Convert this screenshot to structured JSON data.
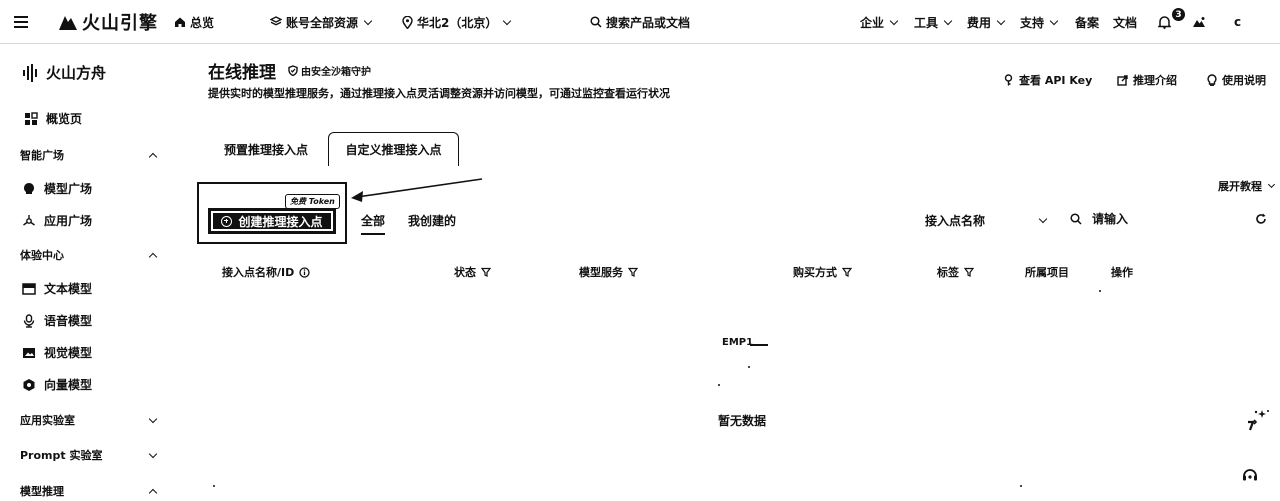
{
  "topbar": {
    "brand": "火山引擎",
    "overview": "总览",
    "account_scope": "账号全部资源",
    "region": "华北2（北京）",
    "search_placeholder": "搜索产品或文档",
    "menus": [
      "企业",
      "工具",
      "费用",
      "支持"
    ],
    "record": "备案",
    "docs": "文档",
    "notification_count": "3",
    "avatar_initial": "c"
  },
  "sidebar": {
    "product": "火山方舟",
    "overview": "概览页",
    "groups": {
      "smart_plaza": "智能广场",
      "experience": "体验中心",
      "app_lab": "应用实验室",
      "prompt_lab": "Prompt 实验室",
      "model_inference": "模型推理"
    },
    "items": {
      "model_plaza": "模型广场",
      "app_plaza": "应用广场",
      "text_model": "文本模型",
      "voice_model": "语音模型",
      "vision_model": "视觉模型",
      "vector_model": "向量模型"
    }
  },
  "main": {
    "title": "在线推理",
    "secure_note": "由安全沙箱守护",
    "subtitle": "提供实时的模型推理服务，通过推理接入点灵活调整资源并访问模型，可通过监控查看运行状况",
    "header_links": {
      "api_key": "查看 API Key",
      "intro": "推理介绍",
      "usage": "使用说明"
    },
    "tabs": [
      "预置推理接入点",
      "自定义推理接入点"
    ],
    "expand_tutorial": "展开教程",
    "free_tag": "免费 Token",
    "create_button": "创建推理接入点",
    "filters": [
      "全部",
      "我创建的"
    ],
    "field_select": "接入点名称",
    "search_placeholder": "请输入",
    "columns": {
      "name": "接入点名称/ID",
      "status": "状态",
      "model_service": "模型服务",
      "purchase": "购买方式",
      "tags": "标签",
      "project": "所属项目",
      "actions": "操作"
    },
    "empty_label": "EMP1",
    "no_data": "暂无数据"
  }
}
